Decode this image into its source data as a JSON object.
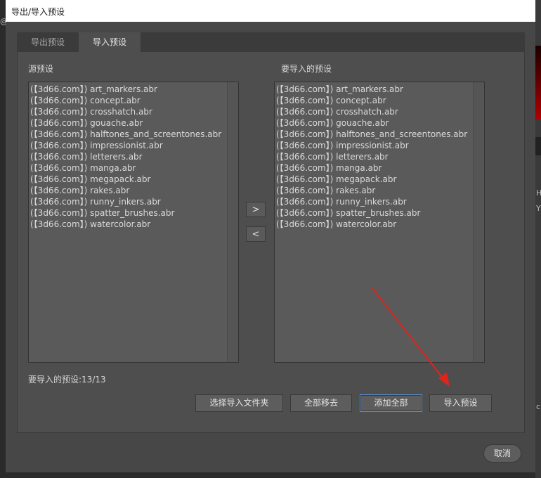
{
  "window": {
    "title": "导出/导入预设"
  },
  "tabs": [
    {
      "label": "导出预设",
      "active": false
    },
    {
      "label": "导入预设",
      "active": true
    }
  ],
  "source": {
    "label": "源预设",
    "items": [
      "(【3d66.com】) art_markers.abr",
      "(【3d66.com】) concept.abr",
      "(【3d66.com】) crosshatch.abr",
      "(【3d66.com】) gouache.abr",
      "(【3d66.com】) halftones_and_screentones.abr",
      "(【3d66.com】) impressionist.abr",
      "(【3d66.com】) letterers.abr",
      "(【3d66.com】) manga.abr",
      "(【3d66.com】) megapack.abr",
      "(【3d66.com】) rakes.abr",
      "(【3d66.com】) runny_inkers.abr",
      "(【3d66.com】) spatter_brushes.abr",
      "(【3d66.com】) watercolor.abr"
    ]
  },
  "target": {
    "label": "要导入的预设",
    "items": [
      "(【3d66.com】) art_markers.abr",
      "(【3d66.com】) concept.abr",
      "(【3d66.com】) crosshatch.abr",
      "(【3d66.com】) gouache.abr",
      "(【3d66.com】) halftones_and_screentones.abr",
      "(【3d66.com】) impressionist.abr",
      "(【3d66.com】) letterers.abr",
      "(【3d66.com】) manga.abr",
      "(【3d66.com】) megapack.abr",
      "(【3d66.com】) rakes.abr",
      "(【3d66.com】) runny_inkers.abr",
      "(【3d66.com】) spatter_brushes.abr",
      "(【3d66.com】) watercolor.abr"
    ]
  },
  "move": {
    "add_label": ">",
    "remove_label": "<"
  },
  "count_text": "要导入的预设:13/13",
  "buttons": {
    "choose_folder": "选择导入文件夹",
    "remove_all": "全部移去",
    "add_all": "添加全部",
    "import": "导入预设",
    "cancel": "取消"
  },
  "background_glyphs": {
    "left": "@",
    "right_1": "H",
    "right_2": "Y",
    "right_3": "c"
  },
  "colors": {
    "annotation_arrow": "#e0241c",
    "focus_border": "#5b8ed6"
  }
}
